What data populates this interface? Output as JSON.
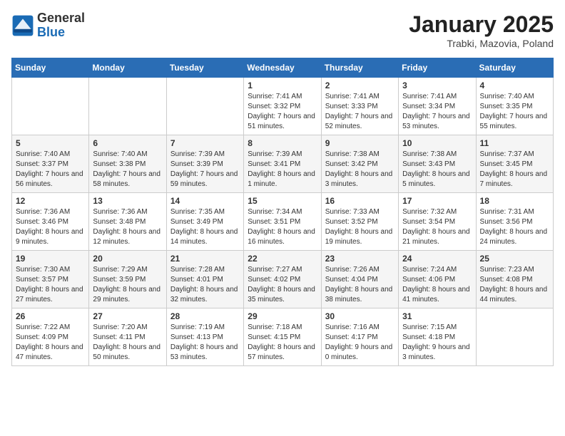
{
  "header": {
    "logo_general": "General",
    "logo_blue": "Blue",
    "month": "January 2025",
    "location": "Trabki, Mazovia, Poland"
  },
  "weekdays": [
    "Sunday",
    "Monday",
    "Tuesday",
    "Wednesday",
    "Thursday",
    "Friday",
    "Saturday"
  ],
  "weeks": [
    [
      {
        "day": "",
        "info": ""
      },
      {
        "day": "",
        "info": ""
      },
      {
        "day": "",
        "info": ""
      },
      {
        "day": "1",
        "info": "Sunrise: 7:41 AM\nSunset: 3:32 PM\nDaylight: 7 hours and 51 minutes."
      },
      {
        "day": "2",
        "info": "Sunrise: 7:41 AM\nSunset: 3:33 PM\nDaylight: 7 hours and 52 minutes."
      },
      {
        "day": "3",
        "info": "Sunrise: 7:41 AM\nSunset: 3:34 PM\nDaylight: 7 hours and 53 minutes."
      },
      {
        "day": "4",
        "info": "Sunrise: 7:40 AM\nSunset: 3:35 PM\nDaylight: 7 hours and 55 minutes."
      }
    ],
    [
      {
        "day": "5",
        "info": "Sunrise: 7:40 AM\nSunset: 3:37 PM\nDaylight: 7 hours and 56 minutes."
      },
      {
        "day": "6",
        "info": "Sunrise: 7:40 AM\nSunset: 3:38 PM\nDaylight: 7 hours and 58 minutes."
      },
      {
        "day": "7",
        "info": "Sunrise: 7:39 AM\nSunset: 3:39 PM\nDaylight: 7 hours and 59 minutes."
      },
      {
        "day": "8",
        "info": "Sunrise: 7:39 AM\nSunset: 3:41 PM\nDaylight: 8 hours and 1 minute."
      },
      {
        "day": "9",
        "info": "Sunrise: 7:38 AM\nSunset: 3:42 PM\nDaylight: 8 hours and 3 minutes."
      },
      {
        "day": "10",
        "info": "Sunrise: 7:38 AM\nSunset: 3:43 PM\nDaylight: 8 hours and 5 minutes."
      },
      {
        "day": "11",
        "info": "Sunrise: 7:37 AM\nSunset: 3:45 PM\nDaylight: 8 hours and 7 minutes."
      }
    ],
    [
      {
        "day": "12",
        "info": "Sunrise: 7:36 AM\nSunset: 3:46 PM\nDaylight: 8 hours and 9 minutes."
      },
      {
        "day": "13",
        "info": "Sunrise: 7:36 AM\nSunset: 3:48 PM\nDaylight: 8 hours and 12 minutes."
      },
      {
        "day": "14",
        "info": "Sunrise: 7:35 AM\nSunset: 3:49 PM\nDaylight: 8 hours and 14 minutes."
      },
      {
        "day": "15",
        "info": "Sunrise: 7:34 AM\nSunset: 3:51 PM\nDaylight: 8 hours and 16 minutes."
      },
      {
        "day": "16",
        "info": "Sunrise: 7:33 AM\nSunset: 3:52 PM\nDaylight: 8 hours and 19 minutes."
      },
      {
        "day": "17",
        "info": "Sunrise: 7:32 AM\nSunset: 3:54 PM\nDaylight: 8 hours and 21 minutes."
      },
      {
        "day": "18",
        "info": "Sunrise: 7:31 AM\nSunset: 3:56 PM\nDaylight: 8 hours and 24 minutes."
      }
    ],
    [
      {
        "day": "19",
        "info": "Sunrise: 7:30 AM\nSunset: 3:57 PM\nDaylight: 8 hours and 27 minutes."
      },
      {
        "day": "20",
        "info": "Sunrise: 7:29 AM\nSunset: 3:59 PM\nDaylight: 8 hours and 29 minutes."
      },
      {
        "day": "21",
        "info": "Sunrise: 7:28 AM\nSunset: 4:01 PM\nDaylight: 8 hours and 32 minutes."
      },
      {
        "day": "22",
        "info": "Sunrise: 7:27 AM\nSunset: 4:02 PM\nDaylight: 8 hours and 35 minutes."
      },
      {
        "day": "23",
        "info": "Sunrise: 7:26 AM\nSunset: 4:04 PM\nDaylight: 8 hours and 38 minutes."
      },
      {
        "day": "24",
        "info": "Sunrise: 7:24 AM\nSunset: 4:06 PM\nDaylight: 8 hours and 41 minutes."
      },
      {
        "day": "25",
        "info": "Sunrise: 7:23 AM\nSunset: 4:08 PM\nDaylight: 8 hours and 44 minutes."
      }
    ],
    [
      {
        "day": "26",
        "info": "Sunrise: 7:22 AM\nSunset: 4:09 PM\nDaylight: 8 hours and 47 minutes."
      },
      {
        "day": "27",
        "info": "Sunrise: 7:20 AM\nSunset: 4:11 PM\nDaylight: 8 hours and 50 minutes."
      },
      {
        "day": "28",
        "info": "Sunrise: 7:19 AM\nSunset: 4:13 PM\nDaylight: 8 hours and 53 minutes."
      },
      {
        "day": "29",
        "info": "Sunrise: 7:18 AM\nSunset: 4:15 PM\nDaylight: 8 hours and 57 minutes."
      },
      {
        "day": "30",
        "info": "Sunrise: 7:16 AM\nSunset: 4:17 PM\nDaylight: 9 hours and 0 minutes."
      },
      {
        "day": "31",
        "info": "Sunrise: 7:15 AM\nSunset: 4:18 PM\nDaylight: 9 hours and 3 minutes."
      },
      {
        "day": "",
        "info": ""
      }
    ]
  ]
}
